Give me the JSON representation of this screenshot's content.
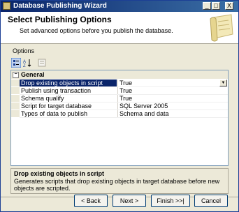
{
  "window": {
    "title": "Database Publishing Wizard"
  },
  "titlebar_buttons": {
    "minimize": "_",
    "maximize": "□",
    "close": "X"
  },
  "header": {
    "title": "Select Publishing Options",
    "subtitle": "Set advanced options before you publish the database."
  },
  "options_label": "Options",
  "toolbar": {
    "icons": [
      "categorized-icon",
      "alphabetical-icon",
      "property-pages-icon"
    ]
  },
  "grid": {
    "category": "General",
    "category_toggle": "−",
    "rows": [
      {
        "name": "Drop existing objects in script",
        "value": "True",
        "selected": true
      },
      {
        "name": "Publish using transaction",
        "value": "True"
      },
      {
        "name": "Schema qualify",
        "value": "True"
      },
      {
        "name": "Script for target database",
        "value": "SQL Server 2005"
      },
      {
        "name": "Types of data to publish",
        "value": "Schema and data"
      }
    ],
    "dropdown_glyph": "▼"
  },
  "description": {
    "title": "Drop existing objects in script",
    "text": "Generates scripts that drop existing objects in target database before new objects are scripted."
  },
  "buttons": {
    "back": "< Back",
    "next": "Next >",
    "finish": "Finish >>|",
    "cancel": "Cancel"
  }
}
